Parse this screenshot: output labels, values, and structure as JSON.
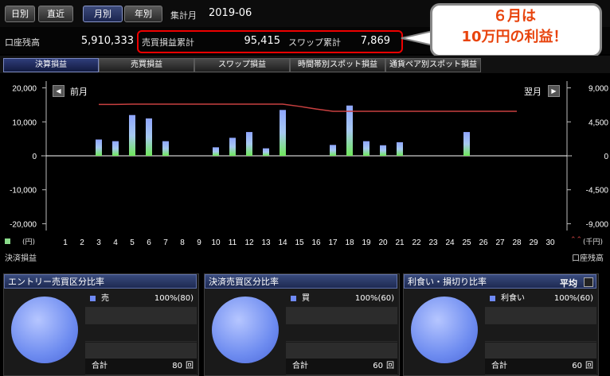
{
  "period_tabs": [
    "日別",
    "直近",
    "月別",
    "年別"
  ],
  "active_period": "月別",
  "period_label": "集計月",
  "period_value": "2019-06",
  "summary": {
    "balance_label": "口座残高",
    "balance_value": "5,910,333",
    "trade_pl_label": "売買損益累計",
    "trade_pl_value": "95,415",
    "swap_label": "スワップ累計",
    "swap_value": "7,869"
  },
  "callout": {
    "line1": "６月は",
    "line2": "10万円の利益！"
  },
  "tabs": [
    "決算損益",
    "売買損益",
    "スワップ損益",
    "時間帯別スポット損益",
    "通貨ペア別スポット損益"
  ],
  "active_tab": "決算損益",
  "chart_nav": {
    "prev": "前月",
    "next": "翌月"
  },
  "legend": {
    "left_unit": "(円)",
    "left_name": "決済損益",
    "right_unit": "(千円)",
    "right_name": "口座残高"
  },
  "chart_data": {
    "type": "bar",
    "x": [
      1,
      2,
      3,
      4,
      5,
      6,
      7,
      8,
      9,
      10,
      11,
      12,
      13,
      14,
      15,
      16,
      17,
      18,
      19,
      20,
      21,
      22,
      23,
      24,
      25,
      26,
      27,
      28,
      29,
      30
    ],
    "series": [
      {
        "name": "決済損益",
        "values": [
          0,
          0,
          4800,
          4300,
          12000,
          11000,
          4300,
          0,
          0,
          2500,
          5300,
          7000,
          2200,
          13500,
          0,
          0,
          3200,
          14800,
          4300,
          3100,
          4000,
          0,
          0,
          0,
          7000,
          0,
          0,
          0,
          0,
          0
        ]
      },
      {
        "name": "口座残高",
        "values": [
          null,
          null,
          6800,
          6800,
          6850,
          6850,
          6850,
          6850,
          6850,
          6850,
          6850,
          6850,
          6850,
          6850,
          6550,
          6200,
          5900,
          5900,
          5900,
          5900,
          5900,
          5900,
          5900,
          5900,
          5900,
          5900,
          5900,
          5900,
          null,
          null
        ]
      }
    ],
    "ylim": [
      -22000,
      22000
    ],
    "yticks_left": [
      "20,000",
      "10,000",
      "0",
      "-10,000",
      "-20,000"
    ],
    "yticks_right": [
      "9,000",
      "4,500",
      "0",
      "-4,500",
      "-9,000"
    ],
    "y2lim": [
      -9900,
      9900
    ]
  },
  "panels": [
    {
      "title": "エントリー売買区分比率",
      "row_label": "売",
      "row_value": "100%(80)",
      "total_label": "合計",
      "total_value": "80",
      "unit": "回"
    },
    {
      "title": "決済売買区分比率",
      "row_label": "買",
      "row_value": "100%(60)",
      "total_label": "合計",
      "total_value": "60",
      "unit": "回"
    },
    {
      "title": "利食い・損切り比率",
      "row_label": "利食い",
      "row_value": "100%(60)",
      "total_label": "合計",
      "total_value": "60",
      "unit": "回",
      "avg_label": "平均"
    }
  ]
}
